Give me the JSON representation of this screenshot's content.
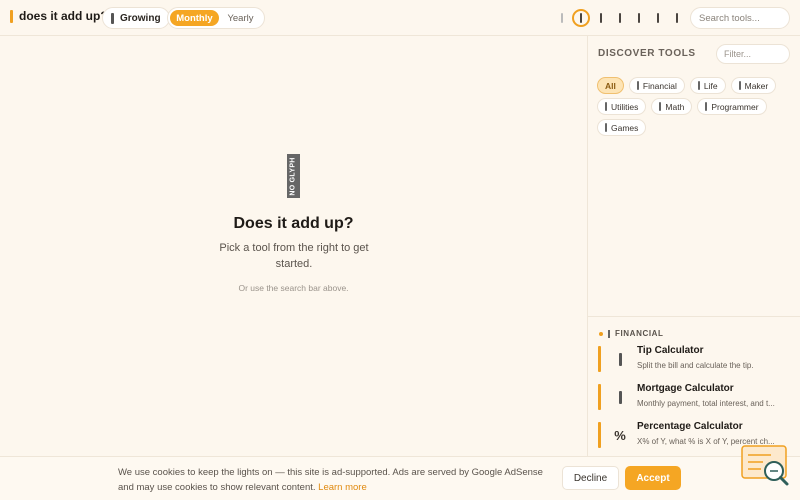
{
  "header": {
    "brand_title": "does it add up?",
    "growing_label": "Growing",
    "billing": {
      "monthly": "Monthly",
      "yearly": "Yearly",
      "selected": "Monthly"
    },
    "search_placeholder": "Search tools..."
  },
  "main": {
    "glyph_text": "NO GLYPH",
    "title": "Does it add up?",
    "subtitle": "Pick a tool from the right to get started.",
    "hint": "Or use the search bar above."
  },
  "sidebar": {
    "heading": "DISCOVER TOOLS",
    "filter_placeholder": "Filter...",
    "chips": [
      {
        "label": "All",
        "active": true
      },
      {
        "label": "Financial"
      },
      {
        "label": "Life"
      },
      {
        "label": "Maker"
      },
      {
        "label": "Utilities"
      },
      {
        "label": "Math"
      },
      {
        "label": "Programmer"
      },
      {
        "label": "Games"
      }
    ],
    "category": "FINANCIAL",
    "tools": [
      {
        "name": "Tip Calculator",
        "desc": "Split the bill and calculate the tip.",
        "icon": "glyph-icon"
      },
      {
        "name": "Mortgage Calculator",
        "desc": "Monthly payment, total interest, and t...",
        "icon": "glyph-icon"
      },
      {
        "name": "Percentage Calculator",
        "desc": "X% of Y, what % is X of Y, percent ch...",
        "icon": "%"
      }
    ]
  },
  "cookie": {
    "text": "We use cookies to keep the lights on — this site is ad-supported. Ads are served by Google AdSense and may use cookies to show relevant content.",
    "link": "Learn more",
    "decline": "Decline",
    "accept": "Accept"
  },
  "colors": {
    "accent": "#f5a623",
    "background": "#fdf7ee"
  }
}
